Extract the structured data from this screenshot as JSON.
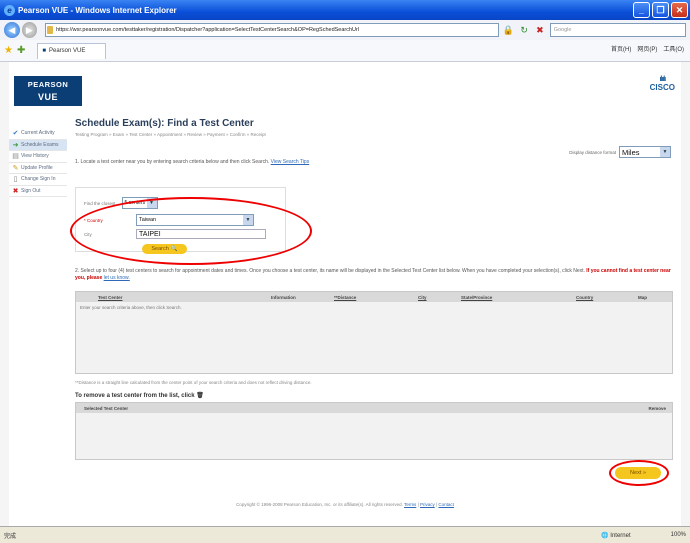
{
  "window": {
    "title": "Pearson VUE - Windows Internet Explorer",
    "min": "_",
    "max": "❐",
    "close": "✕"
  },
  "address": {
    "url": "https://wsr.pearsonvue.com/testtaker/registration/Dispatcher?application=SelectTestCenterSearch&OP=RegSchedSearchUrl",
    "search_placeholder": "Google"
  },
  "tab": {
    "label": "Pearson VUE",
    "tools": [
      "首页(H)",
      "网页(P)",
      "工具(O)"
    ]
  },
  "header": {
    "brand_line1": "PEARSON",
    "brand_line2": "VUE",
    "partner": "CISCO"
  },
  "sidebar": {
    "items": [
      {
        "label": "Current Activity",
        "icon": "✔"
      },
      {
        "label": "Schedule Exams",
        "icon": "➜"
      },
      {
        "label": "View History",
        "icon": "▤"
      },
      {
        "label": "Update Profile",
        "icon": "✎"
      },
      {
        "label": "Change Sign In",
        "icon": "▯"
      },
      {
        "label": "Sign Out",
        "icon": "✖"
      }
    ]
  },
  "main": {
    "title": "Schedule Exam(s): Find a Test Center",
    "breadcrumb": "Testing Program » Exam » Test Center » Appointment » Review » Payment » Confirm » Receipt",
    "distance_label": "Display distance format",
    "distance_value": "Miles",
    "step1": "1. Locate a test center near you by entering search criteria below and then click Search.",
    "step1_link": "View Search Tips",
    "find_label": "Find the closest",
    "find_value": "5 centers",
    "country_label": "* Country",
    "country_value": "Taiwan",
    "city_label": "City",
    "city_value": "TAIPEI",
    "search_button": "Search",
    "step2": "2. Select up to four (4) test centers to search for appointment dates and times. Once you choose a test center, its name will be displayed in the Selected Test Center list below. When you have completed your selection(s), click Next.",
    "step2_warn": "If you cannot find a test center near you, please",
    "step2_link": "let us know.",
    "columns": [
      "Test Center",
      "Information",
      "**Distance",
      "City",
      "State/Province",
      "Country",
      "Map"
    ],
    "empty_msg": "Enter your search criteria above, then click Search.",
    "note": "**Distance is a straight line calculated from the center point of your search criteria and does not reflect driving distance.",
    "remove_text": "To remove a test center from the list, click",
    "selected_header": "Selected Test Center",
    "remove_header": "Remove",
    "next_button": "Next »"
  },
  "footer": {
    "copyright": "Copyright © 1996-2008 Pearson Education, Inc. or its affiliate(s). All rights reserved.",
    "terms": "Terms",
    "privacy": "Privacy",
    "contact": "Contact"
  },
  "status": {
    "left": "完成",
    "zone": "Internet",
    "zoom": "100%"
  }
}
